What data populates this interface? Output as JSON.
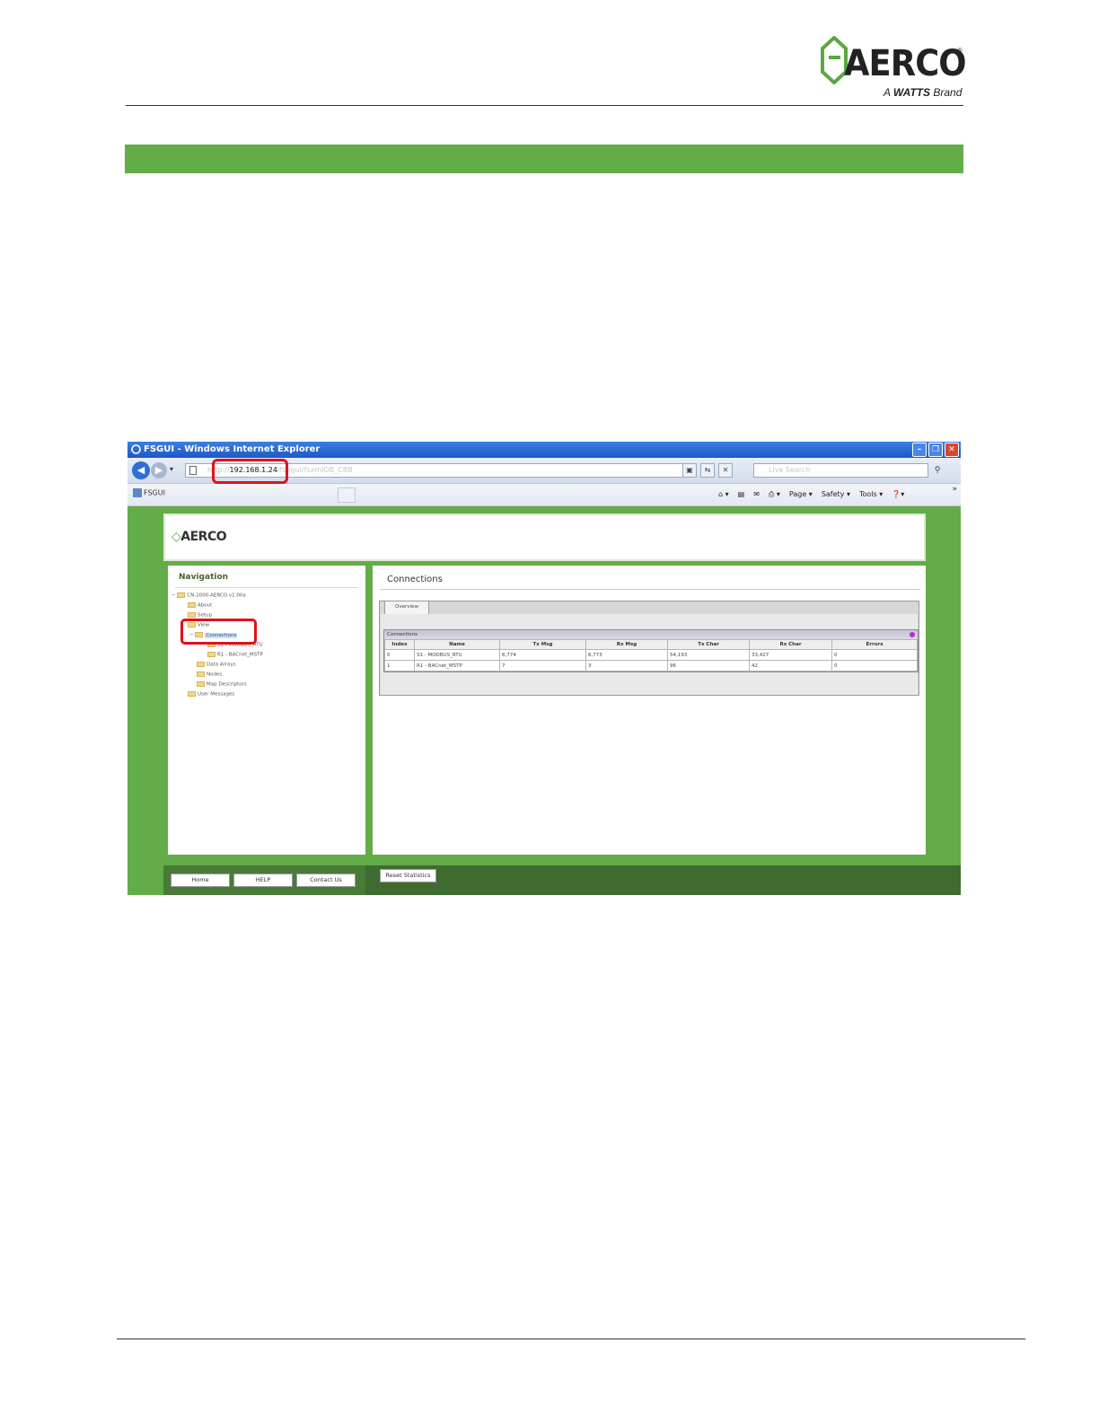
{
  "document": {
    "logo": {
      "word": "AERCO",
      "tag_prefix": "A",
      "tag_brand": "WATTS",
      "tag_suffix": "Brand",
      "registered": "®"
    },
    "colors": {
      "accent_green": "#62ad47",
      "highlight_red": "#e0121b"
    }
  },
  "browser": {
    "window_title": "FSGUI - Windows Internet Explorer",
    "address": {
      "prefix": "http://",
      "ip": "192.168.1.24",
      "suffix": "/fsegui/fsxmlOB_CBB"
    },
    "search_placeholder": "Live Search",
    "tab_label": "FSGUI",
    "command_bar": [
      "Page ▾",
      "Safety ▾",
      "Tools ▾"
    ]
  },
  "app": {
    "logo": "AERCO",
    "nav_title": "Navigation",
    "tree": [
      {
        "label": "CN-1000-AERCO v1.00a",
        "indent": 0,
        "expander": "−"
      },
      {
        "label": "About",
        "indent": 1
      },
      {
        "label": "Setup",
        "indent": 1
      },
      {
        "label": "View",
        "indent": 1
      },
      {
        "label": "Connections",
        "indent": 2,
        "expander": "−",
        "selected": true
      },
      {
        "label": "S1 - MODBUS_RTU",
        "indent": 3
      },
      {
        "label": "R1 - BACnet_MSTP",
        "indent": 3
      },
      {
        "label": "Data Arrays",
        "indent": 2
      },
      {
        "label": "Nodes",
        "indent": 2
      },
      {
        "label": "Map Descriptors",
        "indent": 2
      },
      {
        "label": "User Messages",
        "indent": 1
      }
    ],
    "main_title": "Connections",
    "tab_label": "Overview",
    "grid_caption": "Connections",
    "table": {
      "headers": [
        "Index",
        "Name",
        "Tx Msg",
        "Rx Msg",
        "Tx Char",
        "Rx Char",
        "Errors"
      ],
      "rows": [
        [
          "0",
          "S1 - MODBUS_RTU",
          "6,774",
          "6,773",
          "54,193",
          "33,427",
          "0"
        ],
        [
          "1",
          "R1 - BACnet_MSTP",
          "7",
          "3",
          "96",
          "42",
          "0"
        ]
      ]
    },
    "buttons": {
      "home": "Home",
      "help": "HELP",
      "contact": "Contact Us",
      "reset": "Reset Statistics"
    }
  }
}
